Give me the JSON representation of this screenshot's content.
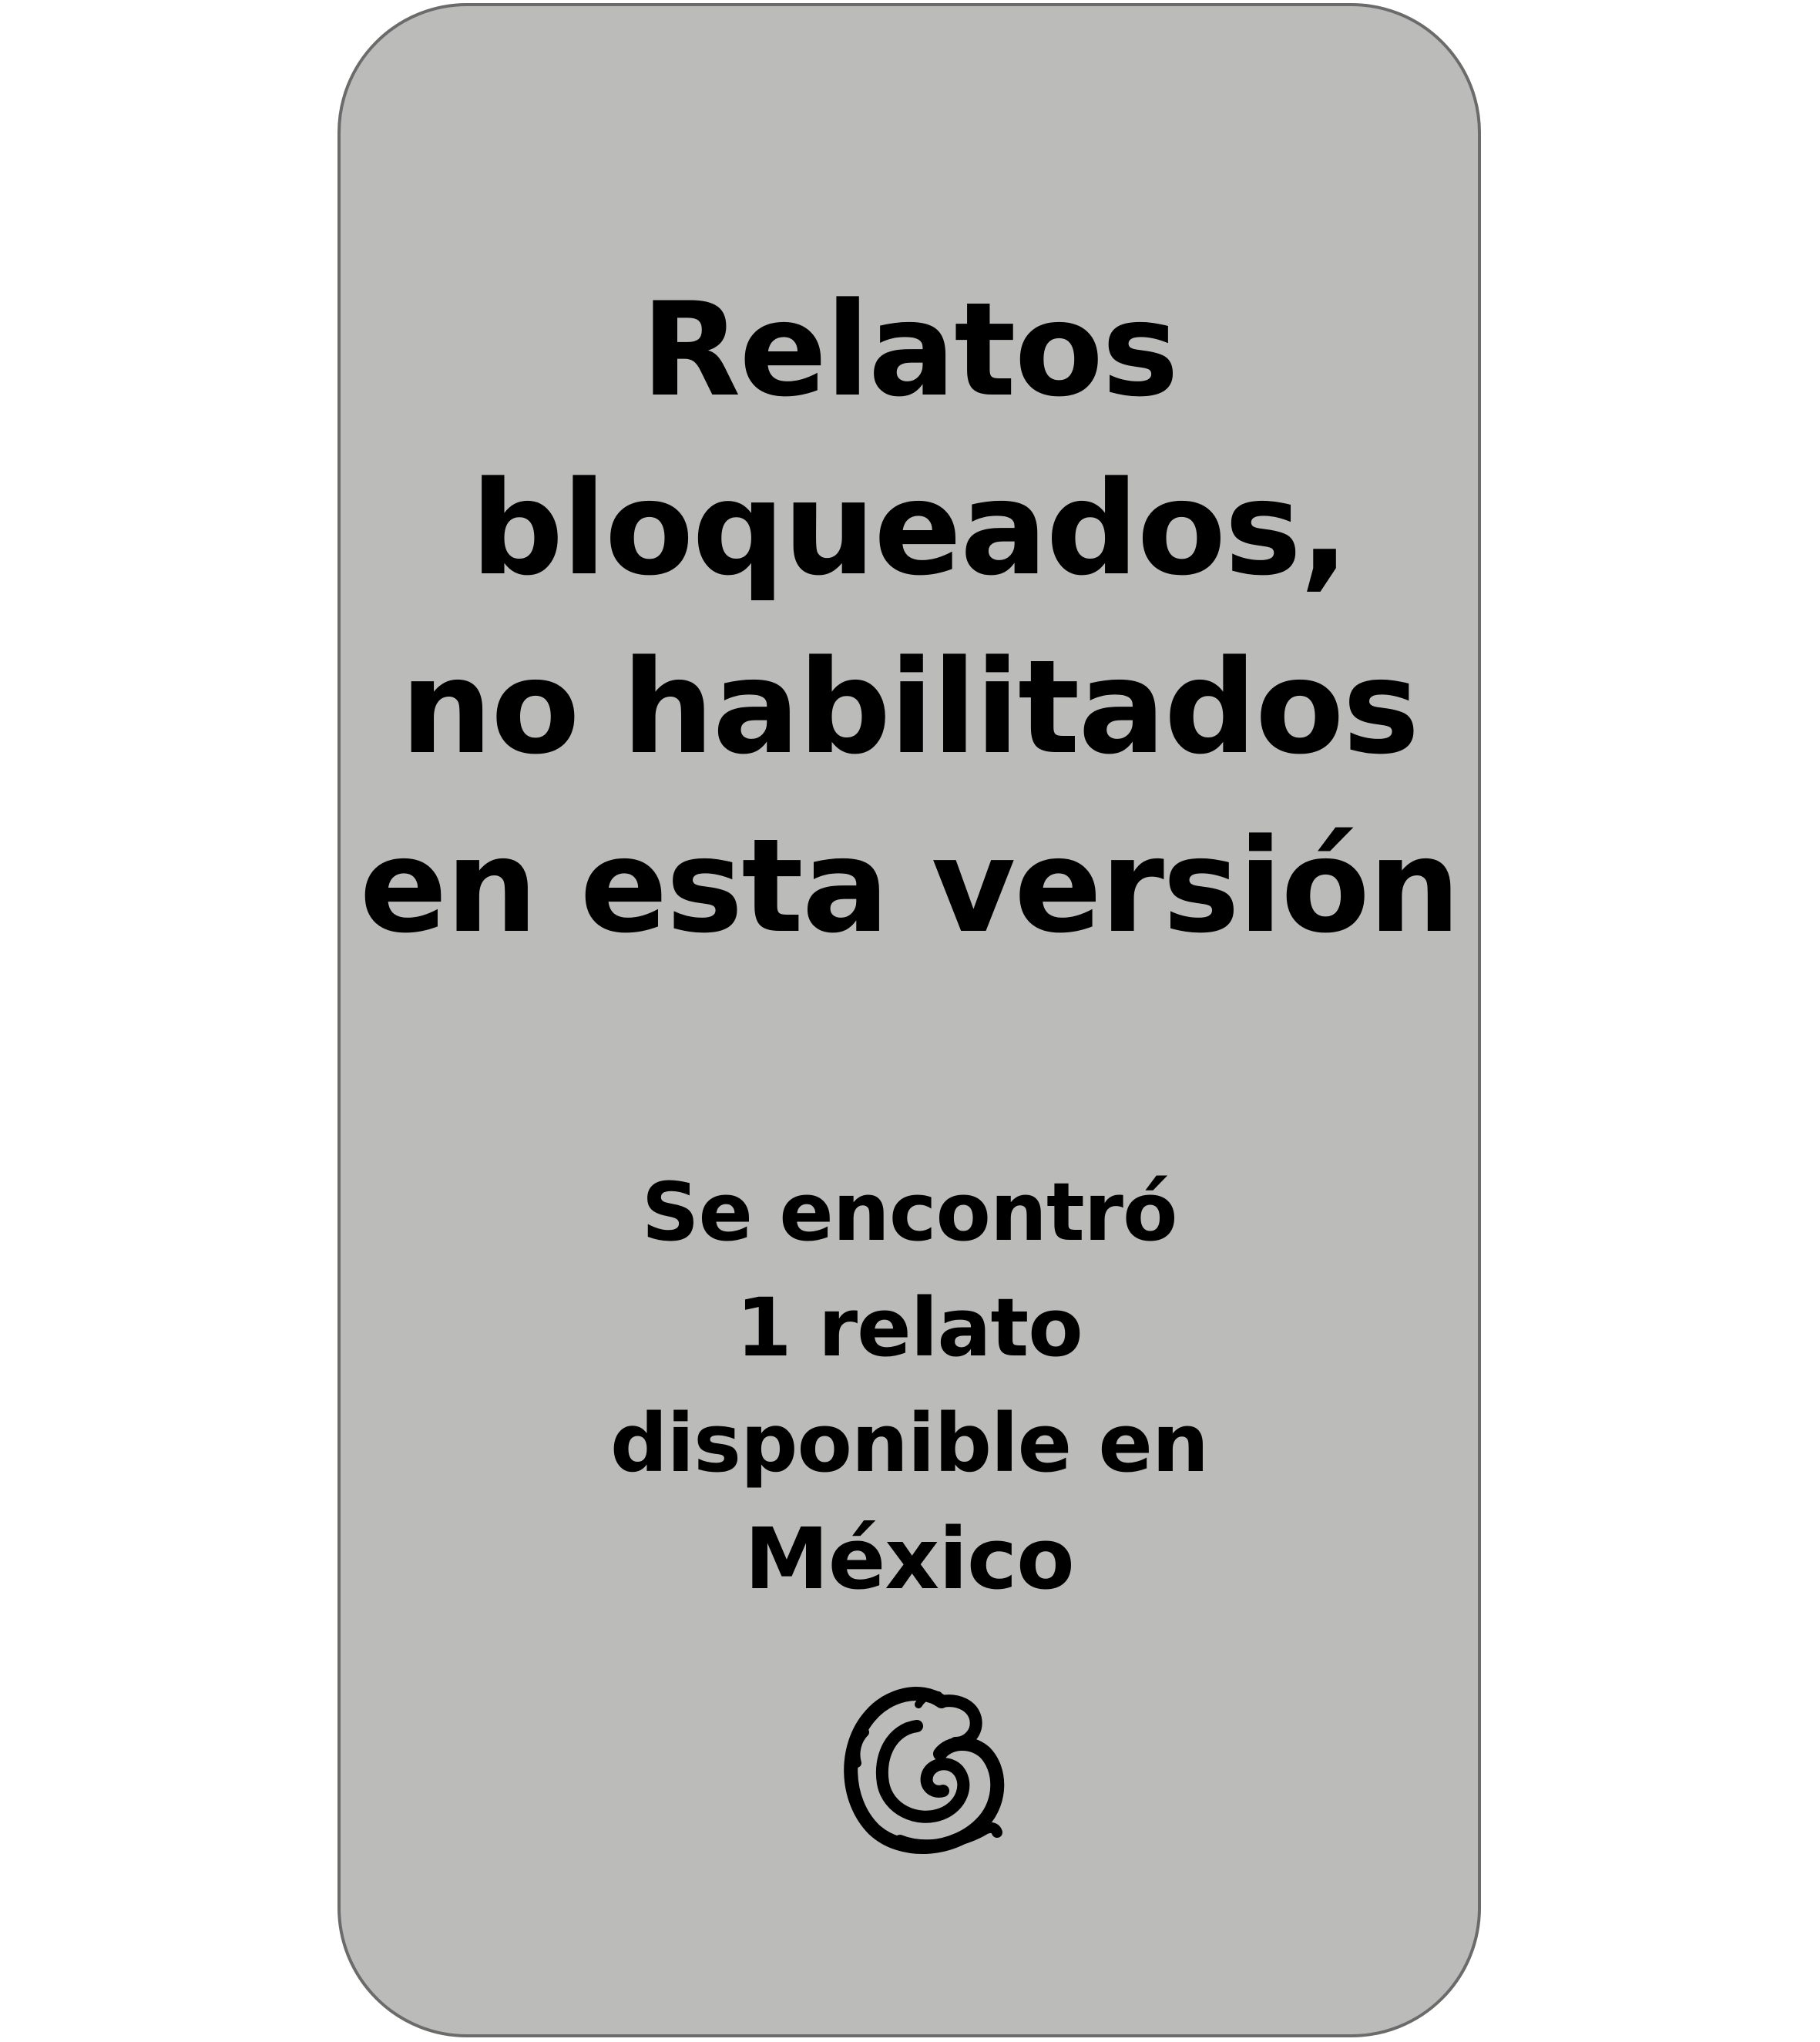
{
  "card": {
    "title_lines": [
      "Relatos",
      "bloqueados,",
      "no habilitados",
      "en esta versión"
    ],
    "message_lines": [
      "Se encontró",
      "1 relato",
      "disponible en"
    ],
    "country": "México",
    "logo_icon": "swirl-logo-icon",
    "background_color": "#bbbbb9",
    "border_color": "#6b6b6b",
    "text_color": "#000000"
  }
}
